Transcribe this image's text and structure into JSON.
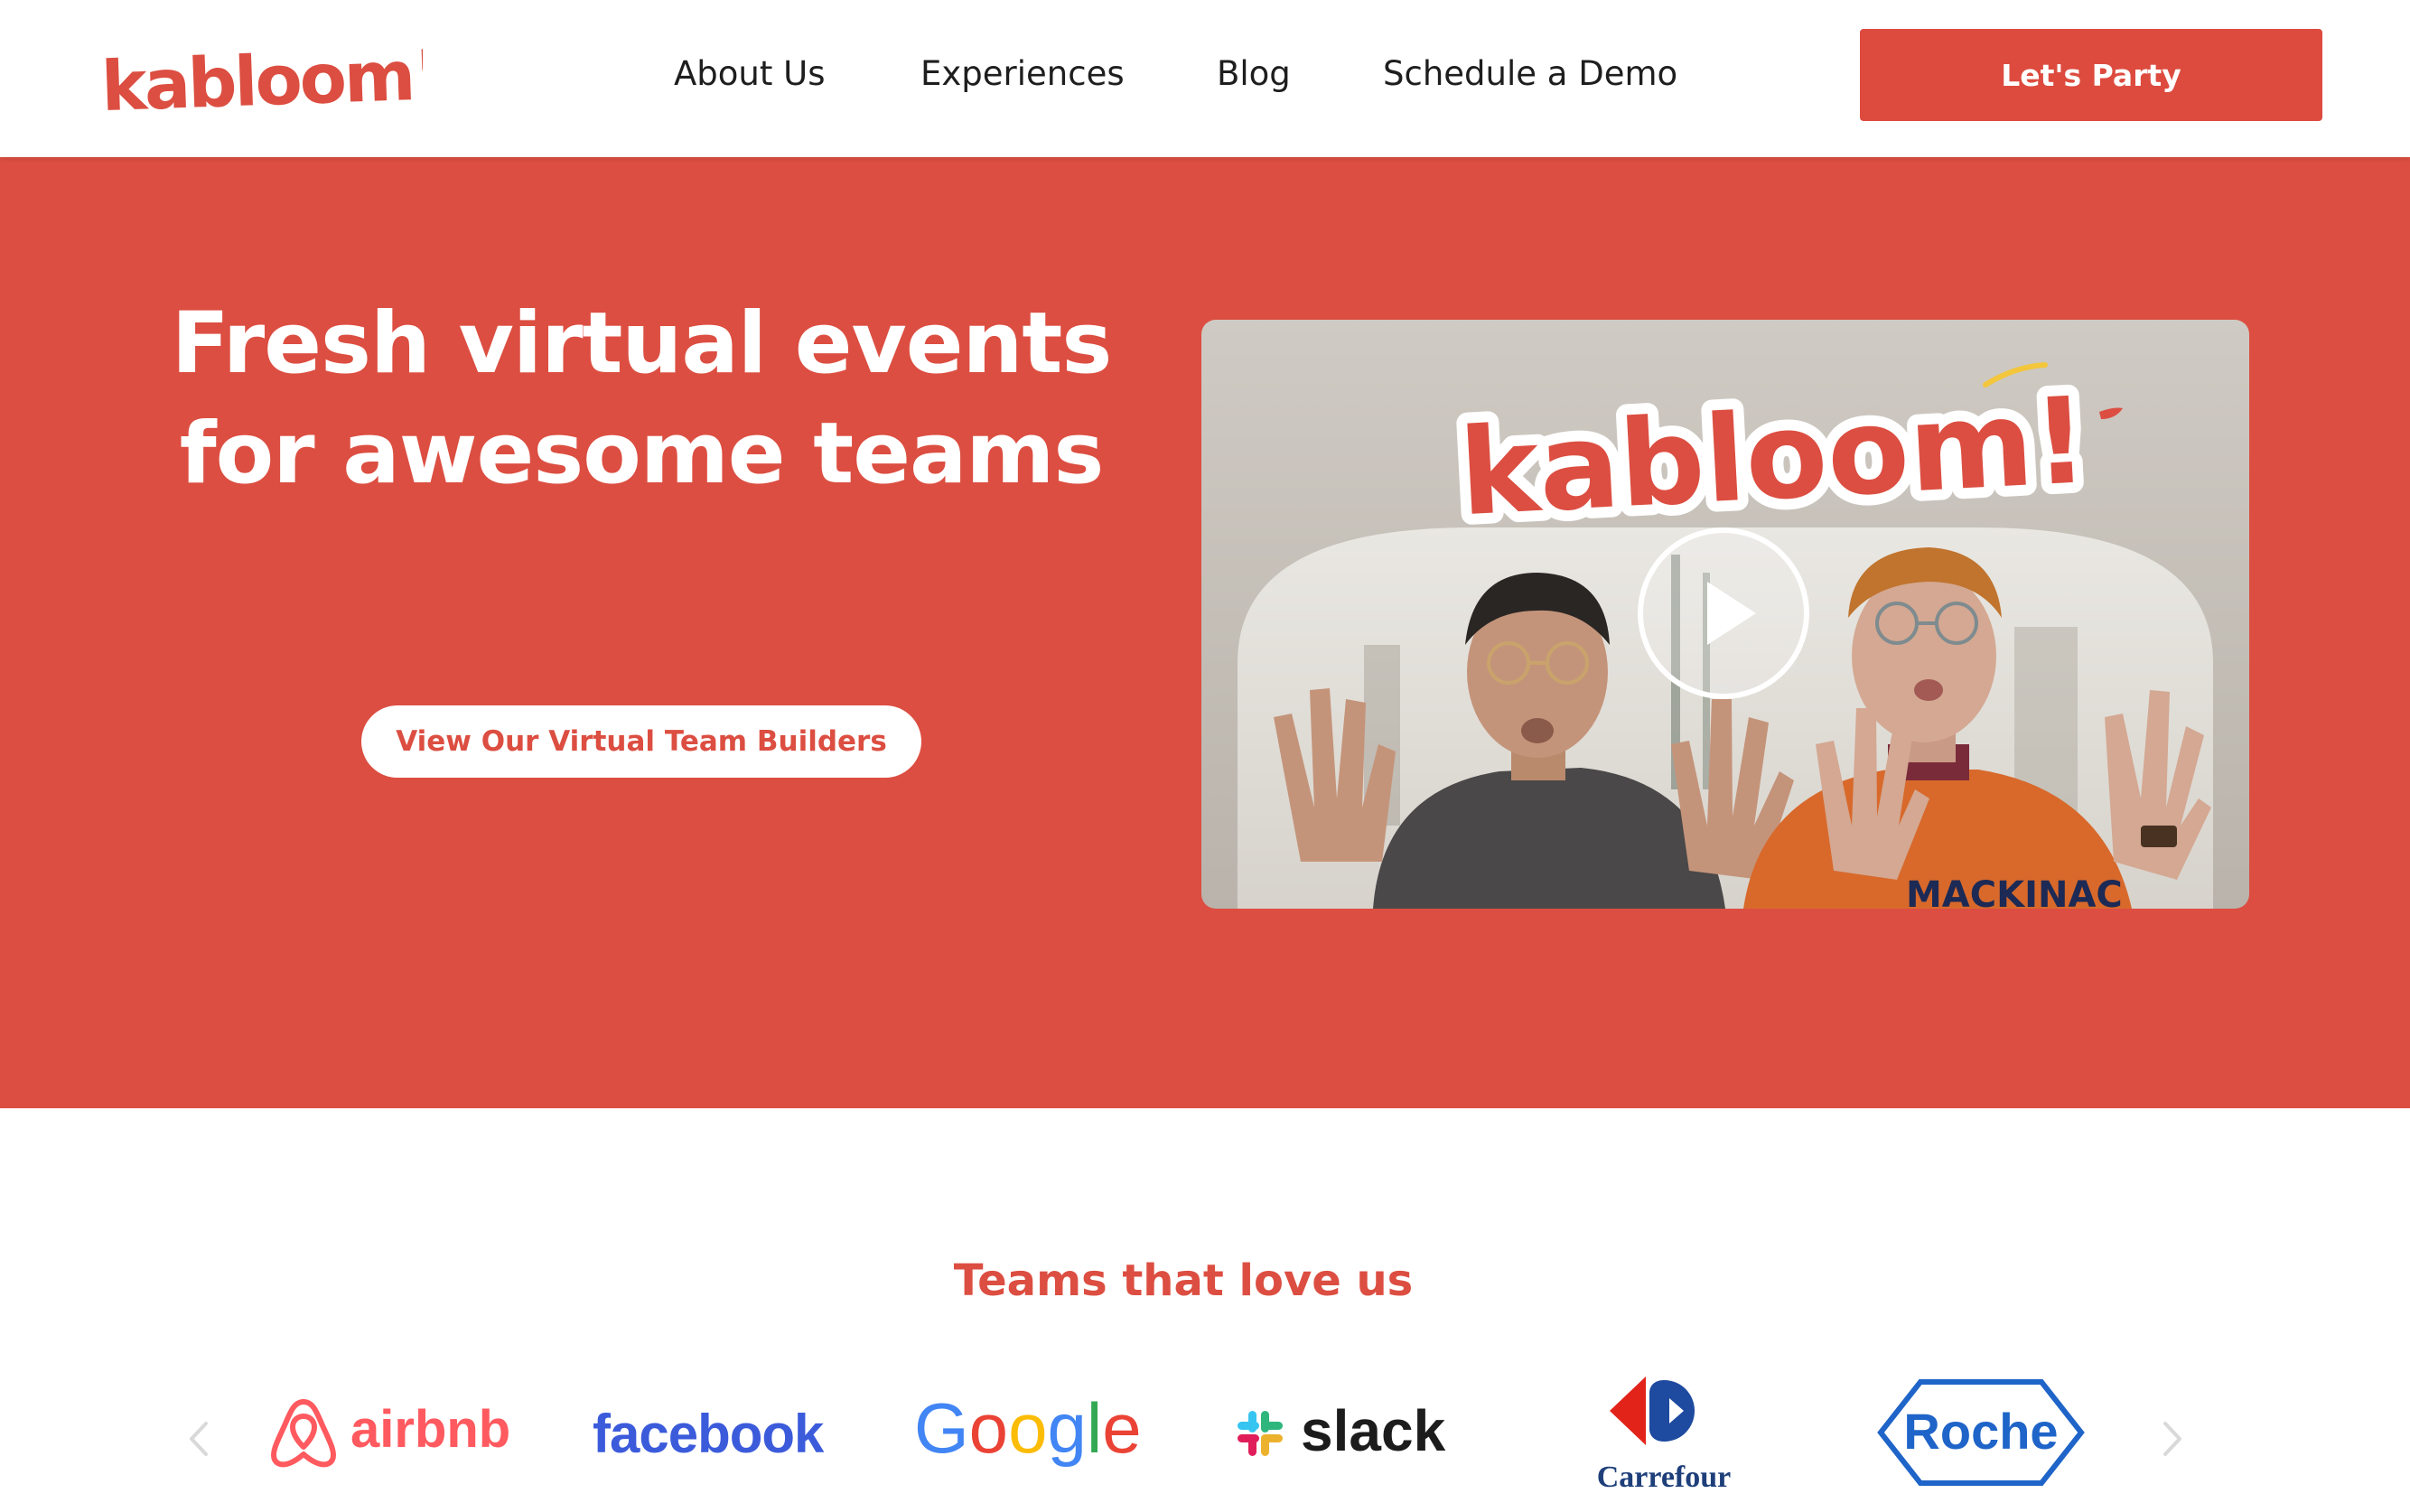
{
  "header": {
    "logo_text": "kabloom!",
    "nav": [
      {
        "label": "About Us"
      },
      {
        "label": "Experiences"
      },
      {
        "label": "Blog"
      },
      {
        "label": "Schedule a Demo"
      }
    ],
    "cta_label": "Let's Party"
  },
  "hero": {
    "title_line1": "Fresh virtual events",
    "title_line2": "for awesome teams",
    "button_label": "View Our Virtual Team Builders",
    "video": {
      "logo_text": "kabloom!",
      "sweater_text": "MACKINAC"
    }
  },
  "teams": {
    "title": "Teams that love us",
    "logos": [
      {
        "name": "airbnb"
      },
      {
        "name": "facebook"
      },
      {
        "name": "Google"
      },
      {
        "name": "slack"
      },
      {
        "name": "Carrefour"
      },
      {
        "name": "Roche"
      }
    ]
  },
  "colors": {
    "brand_red": "#dc4e41",
    "white": "#ffffff",
    "text_dark": "#1e1e1e"
  },
  "icons": [
    "play-icon",
    "chevron-left-icon",
    "chevron-right-icon"
  ]
}
